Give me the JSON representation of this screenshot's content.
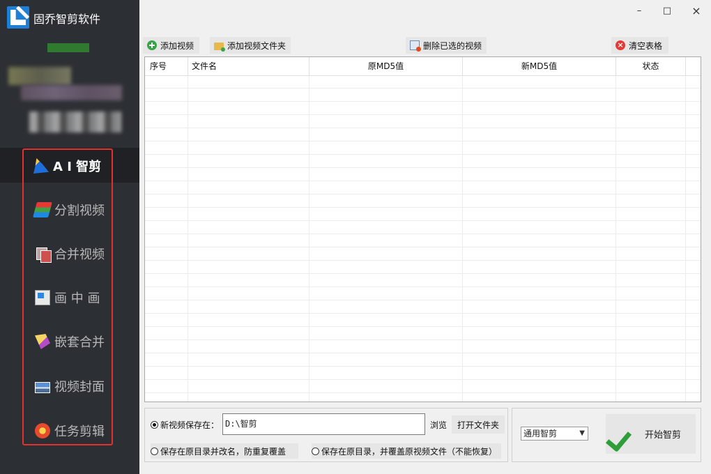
{
  "app": {
    "title": "固乔智剪软件"
  },
  "window": {
    "minimize": "–",
    "maximize": "□",
    "close": "×"
  },
  "sidebar": {
    "items": [
      {
        "label": "A I 智剪",
        "icon": "ai-cut-icon",
        "active": true
      },
      {
        "label": "分割视频",
        "icon": "split-video-icon"
      },
      {
        "label": "合并视频",
        "icon": "merge-video-icon"
      },
      {
        "label": "画 中 画",
        "icon": "picture-in-picture-icon"
      },
      {
        "label": "嵌套合并",
        "icon": "nested-merge-icon"
      },
      {
        "label": "视频封面",
        "icon": "video-cover-icon"
      },
      {
        "label": "任务剪辑",
        "icon": "task-edit-icon"
      }
    ]
  },
  "toolbar": {
    "add_video": "添加视频",
    "add_folder": "添加视频文件夹",
    "delete_selected": "删除已选的视频",
    "clear_table": "清空表格"
  },
  "table": {
    "columns": [
      "序号",
      "文件名",
      "原MD5值",
      "新MD5值",
      "状态"
    ],
    "rows": []
  },
  "save": {
    "option_new_label": "新视频保存在：",
    "path_value": "D:\\智剪",
    "browse": "浏览",
    "open_folder": "打开文件夹",
    "option_rename": "保存在原目录并改名，防重复覆盖",
    "option_overwrite": "保存在原目录，并覆盖原视频文件（不能恢复）",
    "selected": "new"
  },
  "mode": {
    "selected": "通用智剪"
  },
  "start": {
    "label": "开始智剪"
  },
  "colors": {
    "sidebar_bg": "#2c2f33",
    "highlight_border": "#e53030",
    "accent_green": "#2e9d3a"
  }
}
